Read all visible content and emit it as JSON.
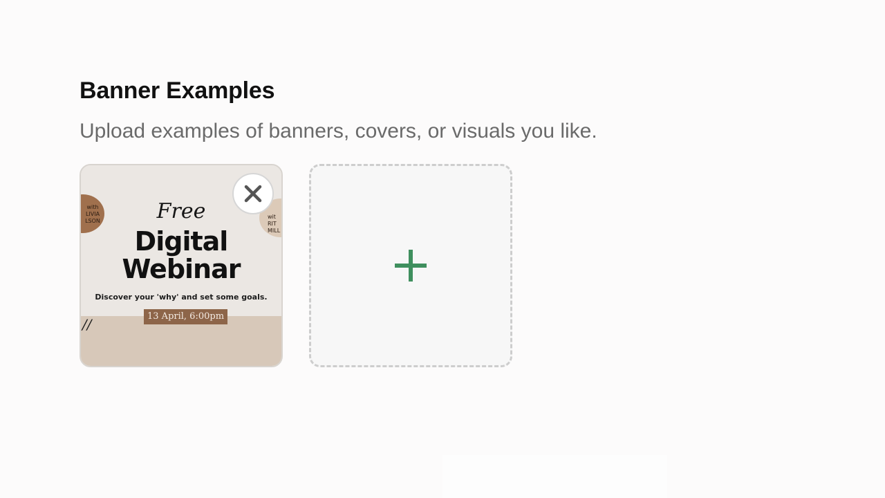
{
  "section": {
    "title": "Banner Examples",
    "subtitle": "Upload examples of banners, covers, or visuals you like."
  },
  "uploaded_images": [
    {
      "banner": {
        "script_text": "Free",
        "headline_line1": "Digital",
        "headline_line2": "Webinar",
        "tagline": "Discover your 'why' and set some goals.",
        "date": "13 April, 6:00pm",
        "left_circle_text": "with\nLIVIA\nLSON",
        "right_circle_text": "wit\nRIT\nMILL",
        "corner_mark": "//"
      },
      "remove_icon": "close-icon"
    }
  ],
  "add_tile": {
    "icon": "plus-icon"
  },
  "colors": {
    "accent_plus": "#3f8f5e",
    "banner_brown": "#8d6549",
    "tile_border": "#d8d4cf",
    "dashed_border": "#cdcdcd"
  }
}
